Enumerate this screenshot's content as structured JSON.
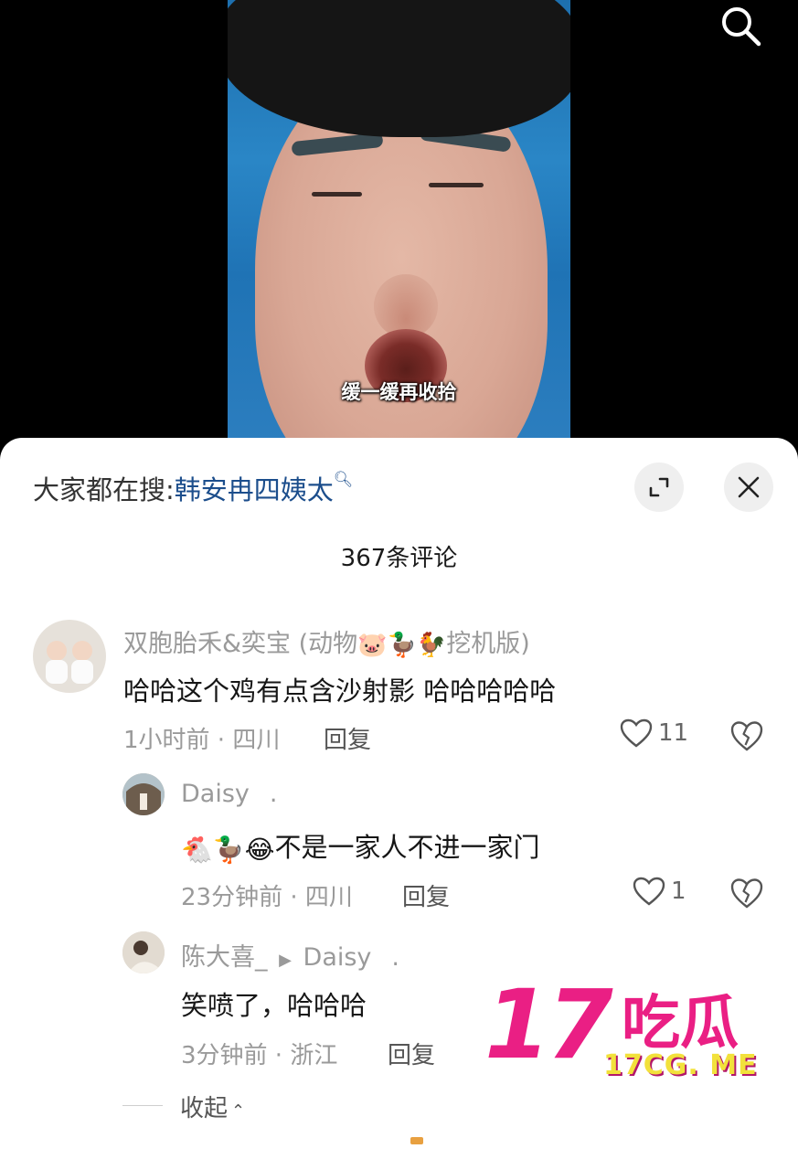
{
  "video": {
    "caption": "缓一缓再收拾"
  },
  "panel": {
    "suggest_prefix": "大家都在搜:",
    "suggest_term": "韩安冉四姨太",
    "comment_count": "367条评论"
  },
  "comments": [
    {
      "username": "双胞胎禾&奕宝 (动物",
      "username_emojis": "🐷🦆🐓",
      "username_suffix": "挖机版)",
      "text": "哈哈这个鸡有点含沙射影 哈哈哈哈哈",
      "meta": "1小时前 · 四川",
      "reply": "回复",
      "likes": "11"
    },
    {
      "username": "Daisy",
      "username_dot": ".",
      "text_emojis": "🐔🦆😂",
      "text": "不是一家人不进一家门",
      "meta": "23分钟前 · 四川",
      "reply": "回复",
      "likes": "1"
    },
    {
      "username": "陈大喜_",
      "reply_to": "Daisy",
      "username_dot": ".",
      "text": "笑喷了，哈哈哈",
      "meta": "3分钟前 · 浙江",
      "reply": "回复"
    }
  ],
  "collapse_label": "收起",
  "watermark": {
    "number": "17",
    "cn": "吃瓜",
    "url": "17CG. ME"
  }
}
